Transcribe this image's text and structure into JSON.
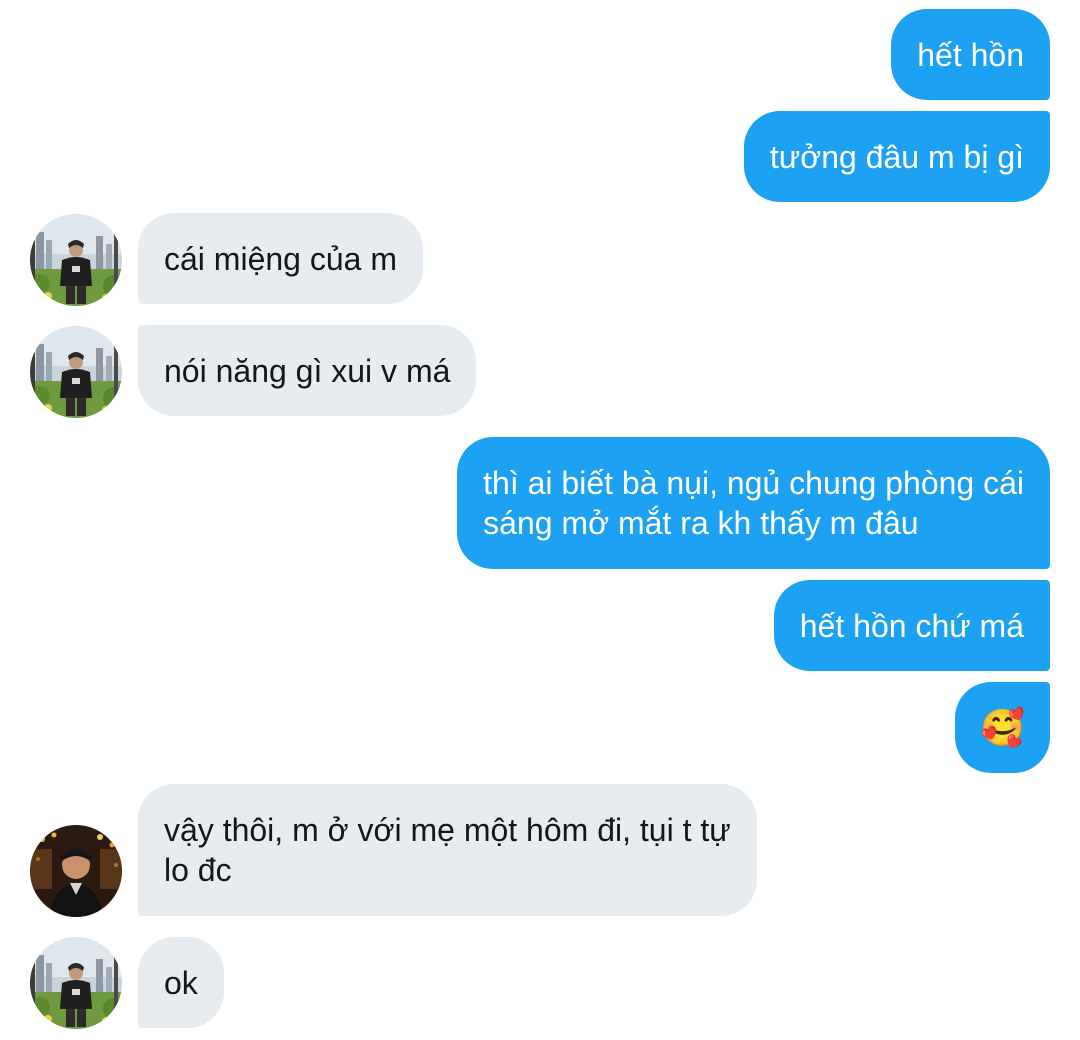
{
  "messages": [
    {
      "side": "out",
      "text": "hết hồn"
    },
    {
      "side": "out",
      "text": "tưởng đâu m bị gì"
    },
    {
      "side": "in",
      "avatar": "person-outdoors-avatar",
      "text": "cái miệng của m"
    },
    {
      "side": "in",
      "avatar": "person-outdoors-avatar",
      "text": "nói năng gì xui v má"
    },
    {
      "side": "out",
      "text": "thì ai biết bà nụi, ngủ chung phòng cái\nsáng mở mắt ra kh thấy m đâu"
    },
    {
      "side": "out",
      "text": "hết hồn chứ má"
    },
    {
      "side": "out",
      "text": "🥰"
    },
    {
      "side": "in",
      "avatar": "person-night-lights-avatar",
      "text": "vậy thôi, m ở với mẹ một hôm đi, tụi t tự\nlo đc"
    },
    {
      "side": "in",
      "avatar": "person-outdoors-avatar",
      "text": "ok"
    }
  ],
  "colors": {
    "outgoing_bubble": "#1da1f2",
    "incoming_bubble": "#e6ecf0",
    "outgoing_text": "#ffffff",
    "incoming_text": "#14171a"
  }
}
